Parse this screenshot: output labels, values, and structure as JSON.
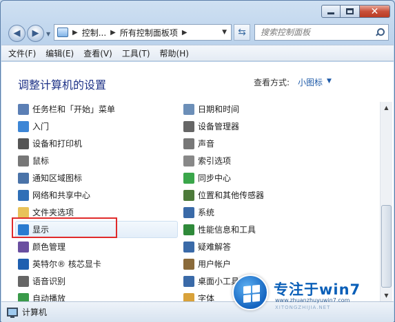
{
  "address": {
    "crumbs": [
      "控制...",
      "所有控制面板项"
    ]
  },
  "search": {
    "placeholder": "搜索控制面板"
  },
  "menu": [
    "文件(F)",
    "编辑(E)",
    "查看(V)",
    "工具(T)",
    "帮助(H)"
  ],
  "content": {
    "heading": "调整计算机的设置",
    "view_by_label": "查看方式:",
    "view_by_value": "小图标"
  },
  "items_left": [
    {
      "label": "任务栏和「开始」菜单",
      "icon": "taskbar-icon",
      "color": "#5b7fb5"
    },
    {
      "label": "入门",
      "icon": "getting-started-icon",
      "color": "#3d86d6"
    },
    {
      "label": "设备和打印机",
      "icon": "printer-icon",
      "color": "#555555"
    },
    {
      "label": "鼠标",
      "icon": "mouse-icon",
      "color": "#777777"
    },
    {
      "label": "通知区域图标",
      "icon": "notification-icon",
      "color": "#4a73a8"
    },
    {
      "label": "网络和共享中心",
      "icon": "network-icon",
      "color": "#2f6fb7"
    },
    {
      "label": "文件夹选项",
      "icon": "folder-icon",
      "color": "#e8c25a"
    },
    {
      "label": "显示",
      "icon": "display-icon",
      "color": "#2a7bd0"
    },
    {
      "label": "颜色管理",
      "icon": "color-management-icon",
      "color": "#6a4fa0"
    },
    {
      "label": "英特尔® 核芯显卡",
      "icon": "intel-graphics-icon",
      "color": "#1f5fb0"
    },
    {
      "label": "语音识别",
      "icon": "microphone-icon",
      "color": "#666666"
    },
    {
      "label": "自动播放",
      "icon": "autoplay-icon",
      "color": "#3a9a4a"
    }
  ],
  "items_right": [
    {
      "label": "日期和时间",
      "icon": "clock-icon",
      "color": "#6c8fb8"
    },
    {
      "label": "设备管理器",
      "icon": "device-manager-icon",
      "color": "#666666"
    },
    {
      "label": "声音",
      "icon": "sound-icon",
      "color": "#777777"
    },
    {
      "label": "索引选项",
      "icon": "indexing-icon",
      "color": "#888888"
    },
    {
      "label": "同步中心",
      "icon": "sync-icon",
      "color": "#3aa64a"
    },
    {
      "label": "位置和其他传感器",
      "icon": "sensor-icon",
      "color": "#4d7a3a"
    },
    {
      "label": "系统",
      "icon": "system-icon",
      "color": "#3a6aa8"
    },
    {
      "label": "性能信息和工具",
      "icon": "performance-icon",
      "color": "#2f8a3a"
    },
    {
      "label": "疑难解答",
      "icon": "troubleshoot-icon",
      "color": "#3a6aa8"
    },
    {
      "label": "用户帐户",
      "icon": "users-icon",
      "color": "#8a6a3a"
    },
    {
      "label": "桌面小工具",
      "icon": "gadgets-icon",
      "color": "#3a6aa8"
    },
    {
      "label": "字体",
      "icon": "fonts-icon",
      "color": "#d9a23a"
    }
  ],
  "status": {
    "text": "计算机"
  },
  "watermark": {
    "title": "专注于win7",
    "url": "www.zhuanzhuyuwin7.com",
    "sub": "XITONGZHIJIA.NET"
  }
}
